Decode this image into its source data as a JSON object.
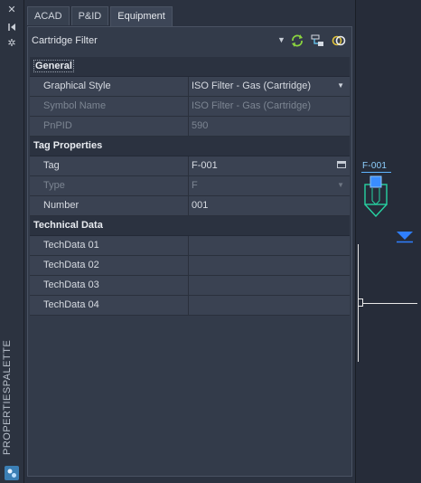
{
  "strip": {
    "title": "PROPERTIESPALETTE"
  },
  "tabs": [
    "ACAD",
    "P&ID",
    "Equipment"
  ],
  "object": {
    "name": "Cartridge Filter"
  },
  "categories": {
    "general": "General",
    "tag": "Tag Properties",
    "tech": "Technical Data"
  },
  "general": [
    {
      "key": "Graphical Style",
      "value": "ISO Filter - Gas (Cartridge)"
    },
    {
      "key": "Symbol Name",
      "value": "ISO Filter - Gas (Cartridge)"
    },
    {
      "key": "PnPID",
      "value": "590"
    }
  ],
  "tagprops": [
    {
      "key": "Tag",
      "value": "F-001"
    },
    {
      "key": "Type",
      "value": "F"
    },
    {
      "key": "Number",
      "value": "001"
    }
  ],
  "tech": [
    {
      "key": "TechData 01",
      "value": ""
    },
    {
      "key": "TechData 02",
      "value": ""
    },
    {
      "key": "TechData 03",
      "value": ""
    },
    {
      "key": "TechData 04",
      "value": ""
    }
  ],
  "drawing": {
    "tag_label": "F-001"
  },
  "colors": {
    "accent": "#5fb4ff",
    "symbol": "#27d3a2",
    "flow_arrow": "#2f7fff"
  }
}
